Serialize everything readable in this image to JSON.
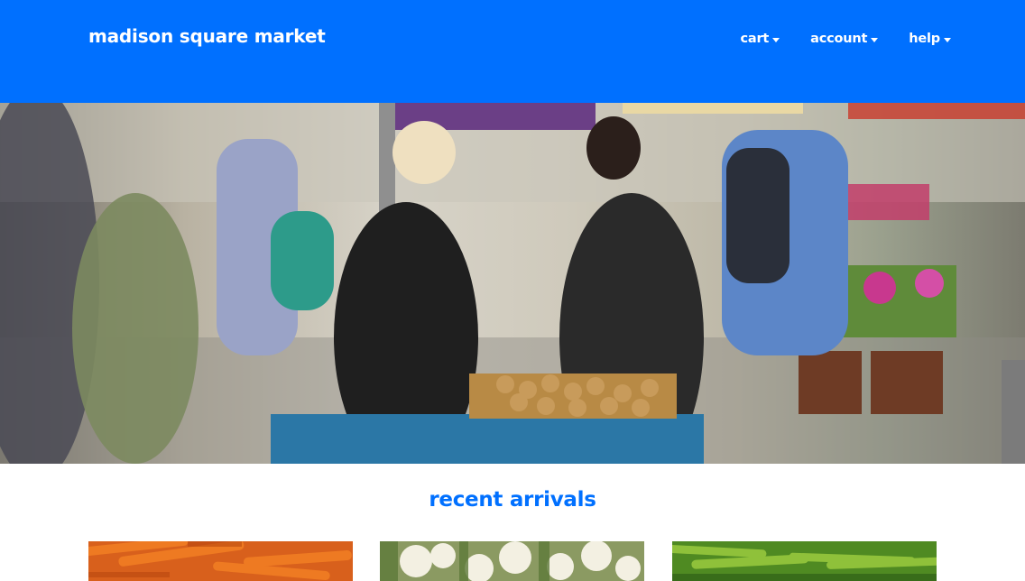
{
  "header": {
    "brand": "madison square market",
    "nav": [
      {
        "label": "cart"
      },
      {
        "label": "account"
      },
      {
        "label": "help"
      }
    ],
    "background_color": "#0070ff"
  },
  "hero": {
    "image": "farmers-market-photo"
  },
  "main": {
    "section_title": "recent arrivals",
    "products": [
      {
        "image": "carrots-photo"
      },
      {
        "image": "cauliflower-photo"
      },
      {
        "image": "green-peppers-photo"
      }
    ]
  },
  "colors": {
    "accent": "#0070ff",
    "header_text": "#ffffff"
  }
}
